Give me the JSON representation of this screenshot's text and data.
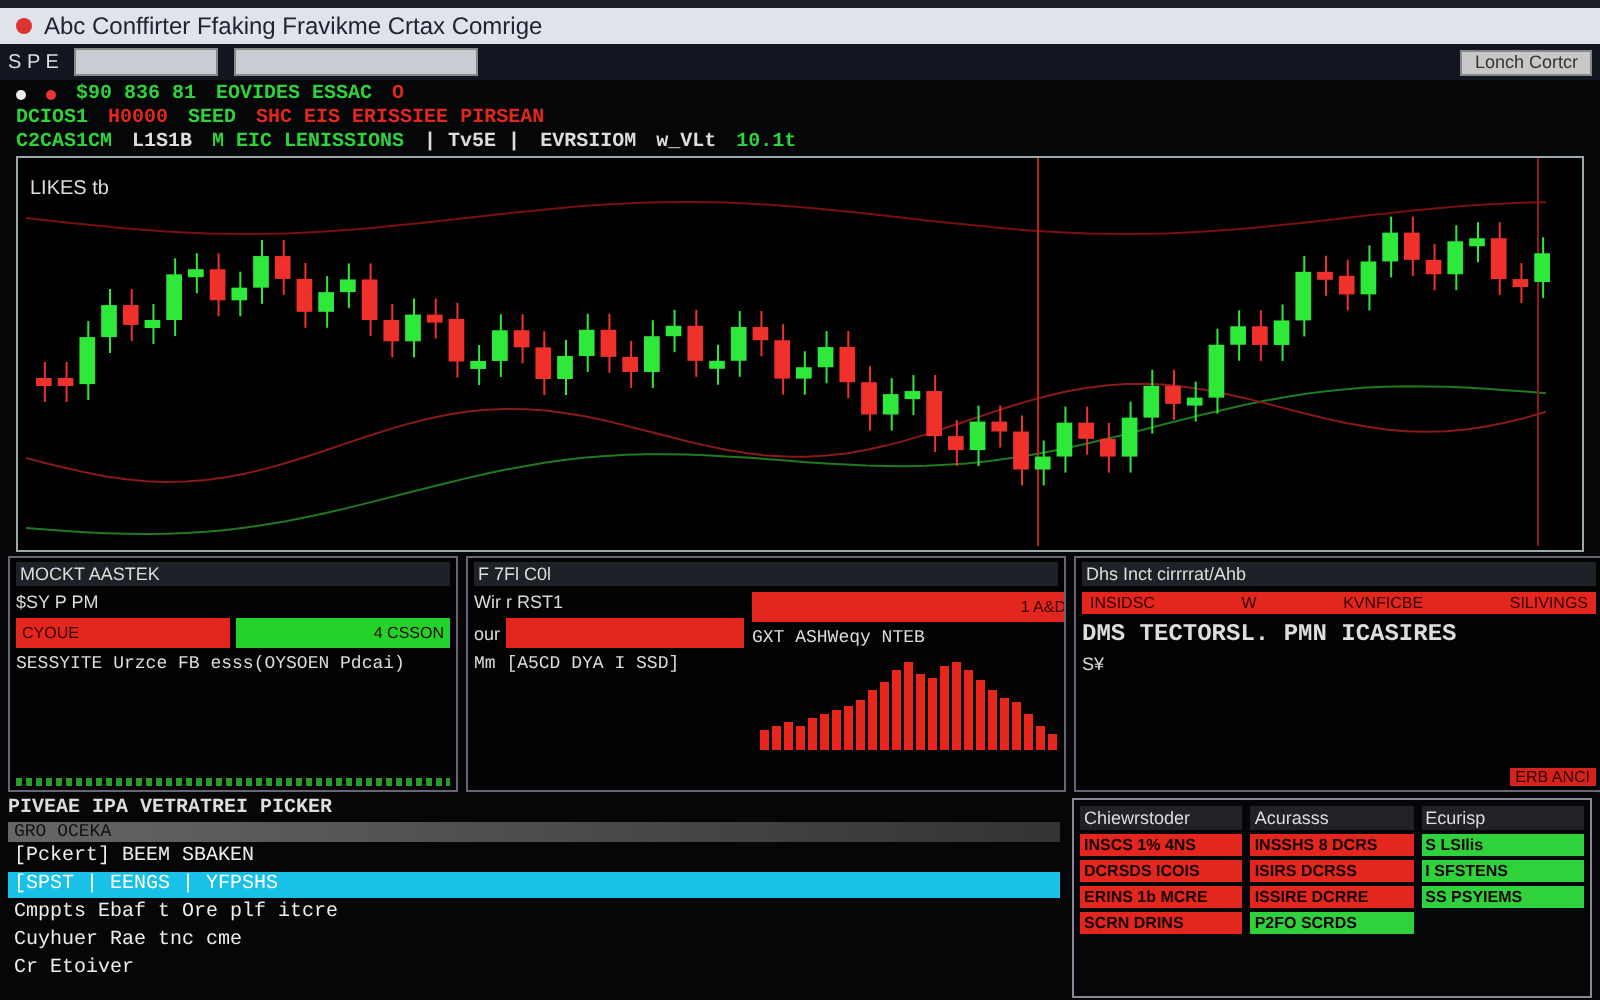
{
  "window": {
    "title": "Abc Conffirter Ffaking Fravikme Crtax Comrige"
  },
  "toolbar": {
    "label": "S P E",
    "button": "Lonch Cortcr"
  },
  "ticker": [
    {
      "segments": [
        {
          "text": "$90 836 81",
          "color": "#2fd23a"
        },
        {
          "text": "EOVIDES ESSAC",
          "color": "#2fd23a"
        },
        {
          "text": "O",
          "color": "#e3261e"
        }
      ]
    },
    {
      "segments": [
        {
          "text": "DCIOS1",
          "color": "#2fd23a"
        },
        {
          "text": "H0000",
          "color": "#e3261e"
        },
        {
          "text": "SEED",
          "color": "#2fd23a"
        },
        {
          "text": "SHC EIS ERISSIEE PIRSEAN",
          "color": "#e3261e"
        }
      ]
    },
    {
      "segments": [
        {
          "text": "C2CAS1CM",
          "color": "#2fd23a"
        },
        {
          "text": "L1S1B",
          "color": "#dddddd"
        },
        {
          "text": "M EIC LENISSIONS",
          "color": "#2fd23a"
        },
        {
          "text": "| Tv5E |",
          "color": "#dddddd"
        },
        {
          "text": "EVRSIIOM",
          "color": "#dddddd"
        },
        {
          "text": "w_VLt",
          "color": "#dddddd"
        },
        {
          "text": "10.1t",
          "color": "#2fd23a"
        }
      ]
    }
  ],
  "chart": {
    "title": "LIKES tb"
  },
  "panels": [
    {
      "header": "MOCKT AASTEK",
      "label": "$SY P PM",
      "bars": [
        {
          "text": "CYOUE",
          "color": "#e3261e"
        },
        {
          "text": "4 CSSON",
          "color": "#22d42a"
        }
      ],
      "text": "SESSYITE Urzce FB esss(OYSOEN Pdcai)"
    },
    {
      "header": "F 7Fl C0l",
      "label": "Wir r RST1",
      "bar_label": "our",
      "bars": [
        {
          "color": "#e3261e"
        },
        {
          "text": "1 A&D",
          "color": "#e3261e"
        }
      ],
      "text": "Mm [A5CD DYA I SSD]",
      "side_text": "GXT ASHWeqy NTEB"
    },
    {
      "header": "Dhs Inct cirrrrat/Ahb",
      "columns": [
        "INSIDSC",
        "W",
        "KVNFICBE",
        "SILIVINGS"
      ],
      "text": "DMS TECTORSL.   PMN ICASIRES",
      "note": "S¥",
      "badge": "ERB ANCI"
    }
  ],
  "list": {
    "title": "PIVEAE IPA VETRATREI PICKER",
    "subheader": "GRO OCEKA",
    "items": [
      {
        "text": "[Pckert]  BEEM SBAKEN",
        "selected": false
      },
      {
        "text": "[SPST | EENGS | YFPSHS",
        "selected": true
      },
      {
        "text": "Cmppts Ebaf t Ore plf itcre",
        "selected": false
      },
      {
        "text": "Cuyhuer Rae tnc cme",
        "selected": false
      },
      {
        "text": "Cr Etoiver",
        "selected": false
      }
    ]
  },
  "grid": {
    "columns": [
      "Chiewrstoder",
      "Acurasss",
      "Ecurisp"
    ],
    "rows": [
      [
        {
          "text": "INSCS 1% 4NS",
          "color": "#e3261e"
        },
        {
          "text": "INSSHS 8 DCRS",
          "color": "#e3261e"
        },
        {
          "text": "S LSIlis",
          "color": "#2fd23a"
        }
      ],
      [
        {
          "text": "DCRSDS ICOIS",
          "color": "#e3261e"
        },
        {
          "text": "ISIRS DCRSS",
          "color": "#e3261e"
        },
        {
          "text": "I SFSTENS",
          "color": "#2fd23a"
        }
      ],
      [
        {
          "text": "ERINS 1b MCRE",
          "color": "#e3261e"
        },
        {
          "text": "ISSIRE DCRRE",
          "color": "#e3261e"
        },
        {
          "text": "SS PSYIEMS",
          "color": "#2fd23a"
        }
      ],
      [
        {
          "text": "SCRN DRINS",
          "color": "#e3261e"
        },
        {
          "text": "P2FO SCRDS",
          "color": "#2fd23a"
        }
      ]
    ]
  }
}
